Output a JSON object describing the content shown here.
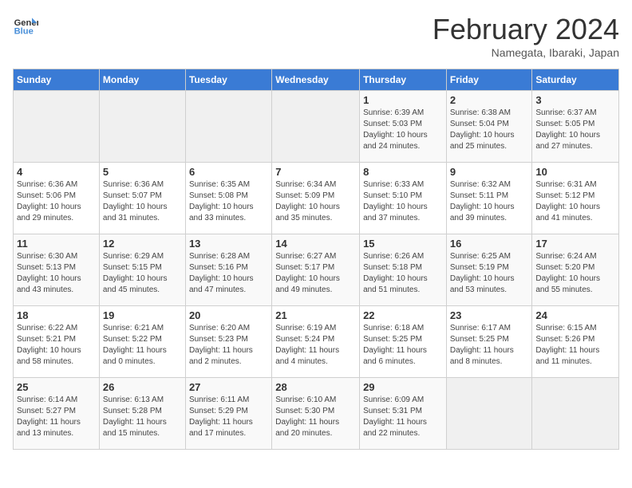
{
  "logo": {
    "line1": "General",
    "line2": "Blue"
  },
  "title": "February 2024",
  "location": "Namegata, Ibaraki, Japan",
  "days_of_week": [
    "Sunday",
    "Monday",
    "Tuesday",
    "Wednesday",
    "Thursday",
    "Friday",
    "Saturday"
  ],
  "weeks": [
    [
      {
        "day": "",
        "info": ""
      },
      {
        "day": "",
        "info": ""
      },
      {
        "day": "",
        "info": ""
      },
      {
        "day": "",
        "info": ""
      },
      {
        "day": "1",
        "info": "Sunrise: 6:39 AM\nSunset: 5:03 PM\nDaylight: 10 hours\nand 24 minutes."
      },
      {
        "day": "2",
        "info": "Sunrise: 6:38 AM\nSunset: 5:04 PM\nDaylight: 10 hours\nand 25 minutes."
      },
      {
        "day": "3",
        "info": "Sunrise: 6:37 AM\nSunset: 5:05 PM\nDaylight: 10 hours\nand 27 minutes."
      }
    ],
    [
      {
        "day": "4",
        "info": "Sunrise: 6:36 AM\nSunset: 5:06 PM\nDaylight: 10 hours\nand 29 minutes."
      },
      {
        "day": "5",
        "info": "Sunrise: 6:36 AM\nSunset: 5:07 PM\nDaylight: 10 hours\nand 31 minutes."
      },
      {
        "day": "6",
        "info": "Sunrise: 6:35 AM\nSunset: 5:08 PM\nDaylight: 10 hours\nand 33 minutes."
      },
      {
        "day": "7",
        "info": "Sunrise: 6:34 AM\nSunset: 5:09 PM\nDaylight: 10 hours\nand 35 minutes."
      },
      {
        "day": "8",
        "info": "Sunrise: 6:33 AM\nSunset: 5:10 PM\nDaylight: 10 hours\nand 37 minutes."
      },
      {
        "day": "9",
        "info": "Sunrise: 6:32 AM\nSunset: 5:11 PM\nDaylight: 10 hours\nand 39 minutes."
      },
      {
        "day": "10",
        "info": "Sunrise: 6:31 AM\nSunset: 5:12 PM\nDaylight: 10 hours\nand 41 minutes."
      }
    ],
    [
      {
        "day": "11",
        "info": "Sunrise: 6:30 AM\nSunset: 5:13 PM\nDaylight: 10 hours\nand 43 minutes."
      },
      {
        "day": "12",
        "info": "Sunrise: 6:29 AM\nSunset: 5:15 PM\nDaylight: 10 hours\nand 45 minutes."
      },
      {
        "day": "13",
        "info": "Sunrise: 6:28 AM\nSunset: 5:16 PM\nDaylight: 10 hours\nand 47 minutes."
      },
      {
        "day": "14",
        "info": "Sunrise: 6:27 AM\nSunset: 5:17 PM\nDaylight: 10 hours\nand 49 minutes."
      },
      {
        "day": "15",
        "info": "Sunrise: 6:26 AM\nSunset: 5:18 PM\nDaylight: 10 hours\nand 51 minutes."
      },
      {
        "day": "16",
        "info": "Sunrise: 6:25 AM\nSunset: 5:19 PM\nDaylight: 10 hours\nand 53 minutes."
      },
      {
        "day": "17",
        "info": "Sunrise: 6:24 AM\nSunset: 5:20 PM\nDaylight: 10 hours\nand 55 minutes."
      }
    ],
    [
      {
        "day": "18",
        "info": "Sunrise: 6:22 AM\nSunset: 5:21 PM\nDaylight: 10 hours\nand 58 minutes."
      },
      {
        "day": "19",
        "info": "Sunrise: 6:21 AM\nSunset: 5:22 PM\nDaylight: 11 hours\nand 0 minutes."
      },
      {
        "day": "20",
        "info": "Sunrise: 6:20 AM\nSunset: 5:23 PM\nDaylight: 11 hours\nand 2 minutes."
      },
      {
        "day": "21",
        "info": "Sunrise: 6:19 AM\nSunset: 5:24 PM\nDaylight: 11 hours\nand 4 minutes."
      },
      {
        "day": "22",
        "info": "Sunrise: 6:18 AM\nSunset: 5:25 PM\nDaylight: 11 hours\nand 6 minutes."
      },
      {
        "day": "23",
        "info": "Sunrise: 6:17 AM\nSunset: 5:25 PM\nDaylight: 11 hours\nand 8 minutes."
      },
      {
        "day": "24",
        "info": "Sunrise: 6:15 AM\nSunset: 5:26 PM\nDaylight: 11 hours\nand 11 minutes."
      }
    ],
    [
      {
        "day": "25",
        "info": "Sunrise: 6:14 AM\nSunset: 5:27 PM\nDaylight: 11 hours\nand 13 minutes."
      },
      {
        "day": "26",
        "info": "Sunrise: 6:13 AM\nSunset: 5:28 PM\nDaylight: 11 hours\nand 15 minutes."
      },
      {
        "day": "27",
        "info": "Sunrise: 6:11 AM\nSunset: 5:29 PM\nDaylight: 11 hours\nand 17 minutes."
      },
      {
        "day": "28",
        "info": "Sunrise: 6:10 AM\nSunset: 5:30 PM\nDaylight: 11 hours\nand 20 minutes."
      },
      {
        "day": "29",
        "info": "Sunrise: 6:09 AM\nSunset: 5:31 PM\nDaylight: 11 hours\nand 22 minutes."
      },
      {
        "day": "",
        "info": ""
      },
      {
        "day": "",
        "info": ""
      }
    ]
  ]
}
